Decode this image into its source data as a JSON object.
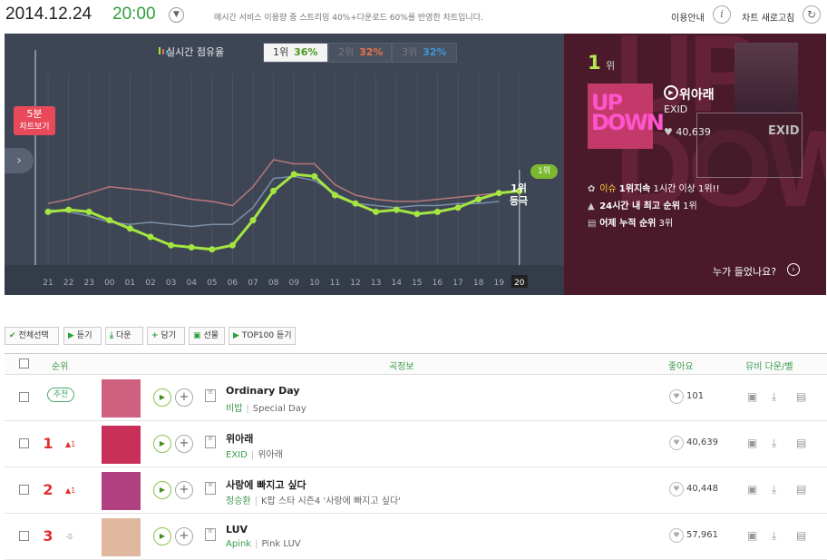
{
  "header": {
    "date": "2014.12.24",
    "time": "20:00",
    "notice": "매시간 서비스 이용량 중 스트리밍 40%+다운로드 60%를 반영한 차트입니다.",
    "info_label": "이용안내",
    "refresh_label": "차트 새로고침"
  },
  "chart_panel": {
    "share_label": "실시간 점유율",
    "rank_tabs": [
      {
        "rank": "1위",
        "pct": "36%",
        "color": "#4a9a1a"
      },
      {
        "rank": "2위",
        "pct": "32%",
        "color": "#e8724a"
      },
      {
        "rank": "3위",
        "pct": "32%",
        "color": "#3a9ad8"
      }
    ],
    "five_min_label": "5분",
    "five_min_sub": "차트보기",
    "current_badge": "1위",
    "current_label": "1위",
    "current_sub": "등극"
  },
  "chart_data": {
    "type": "line",
    "x": [
      "21",
      "22",
      "23",
      "00",
      "01",
      "02",
      "03",
      "04",
      "05",
      "06",
      "07",
      "08",
      "09",
      "10",
      "11",
      "12",
      "13",
      "14",
      "15",
      "16",
      "17",
      "18",
      "19",
      "20"
    ],
    "series": [
      {
        "name": "1위",
        "values": [
          36,
          36.5,
          36,
          34,
          32,
          30,
          28,
          27.5,
          27,
          28,
          34,
          41,
          45,
          44.5,
          40,
          38,
          36,
          36.5,
          35.5,
          36,
          37,
          39,
          40.5,
          41
        ],
        "color": "#a4e640"
      },
      {
        "name": "2위",
        "values": [
          38,
          39,
          40.5,
          42,
          41.5,
          41,
          40,
          39,
          38.5,
          37.5,
          42,
          48.5,
          47.5,
          47.5,
          42.5,
          40,
          39,
          38.5,
          38.5,
          39,
          39.5,
          40,
          40.5,
          null
        ],
        "color": "#b8787a"
      },
      {
        "name": "3위",
        "values": [
          36.5,
          36,
          35,
          33.5,
          33,
          33.5,
          33,
          32.5,
          33,
          33,
          37,
          44,
          44.5,
          43.5,
          40.5,
          38,
          37.5,
          37,
          37.5,
          37.5,
          38,
          38,
          38.5,
          null
        ],
        "color": "#7a90a8"
      }
    ],
    "ylim": [
      20,
      60
    ]
  },
  "side": {
    "rank": "1",
    "rank_suffix": "위",
    "song": "위아래",
    "artist": "EXID",
    "likes": "40,639",
    "issue_label": "이슈",
    "issue_text": "1위지속",
    "issue_rest": "1시간 이상 1위!!",
    "peak_text": "24시간 내 최고 순위",
    "peak_val": "1위",
    "yesterday_text": "어제 누적 순위",
    "yesterday_val": "3위",
    "who_listened": "누가 들었나요?",
    "album_art_text": "UP DOWN"
  },
  "toolbar": {
    "select_all": "전체선택",
    "listen": "듣기",
    "download": "다운",
    "add": "담기",
    "gift": "선물",
    "top100": "TOP100 듣기"
  },
  "table_header": {
    "rank": "순위",
    "song_info": "곡정보",
    "likes": "좋아요",
    "extra": "뮤비 다운/벨"
  },
  "rows": [
    {
      "rank": "",
      "badge": "추천",
      "change": "",
      "song": "Ordinary Day",
      "artist": "비밥",
      "album": "Special Day",
      "likes": "101",
      "art_color": "#d06080"
    },
    {
      "rank": "1",
      "badge": "",
      "change": "▲1",
      "song": "위아래",
      "artist": "EXID",
      "album": "위아래",
      "likes": "40,639",
      "art_color": "#c8305a"
    },
    {
      "rank": "2",
      "badge": "",
      "change": "▲1",
      "song": "사랑에 빠지고 싶다",
      "artist": "정승환",
      "album": "K팝 스타 시즌4 '사랑에 빠지고 싶다'",
      "likes": "40,448",
      "art_color": "#b04080"
    },
    {
      "rank": "3",
      "badge": "",
      "change": "-0",
      "song": "LUV",
      "artist": "Apink",
      "album": "Pink LUV",
      "likes": "57,961",
      "art_color": "#e0b8a0"
    }
  ]
}
